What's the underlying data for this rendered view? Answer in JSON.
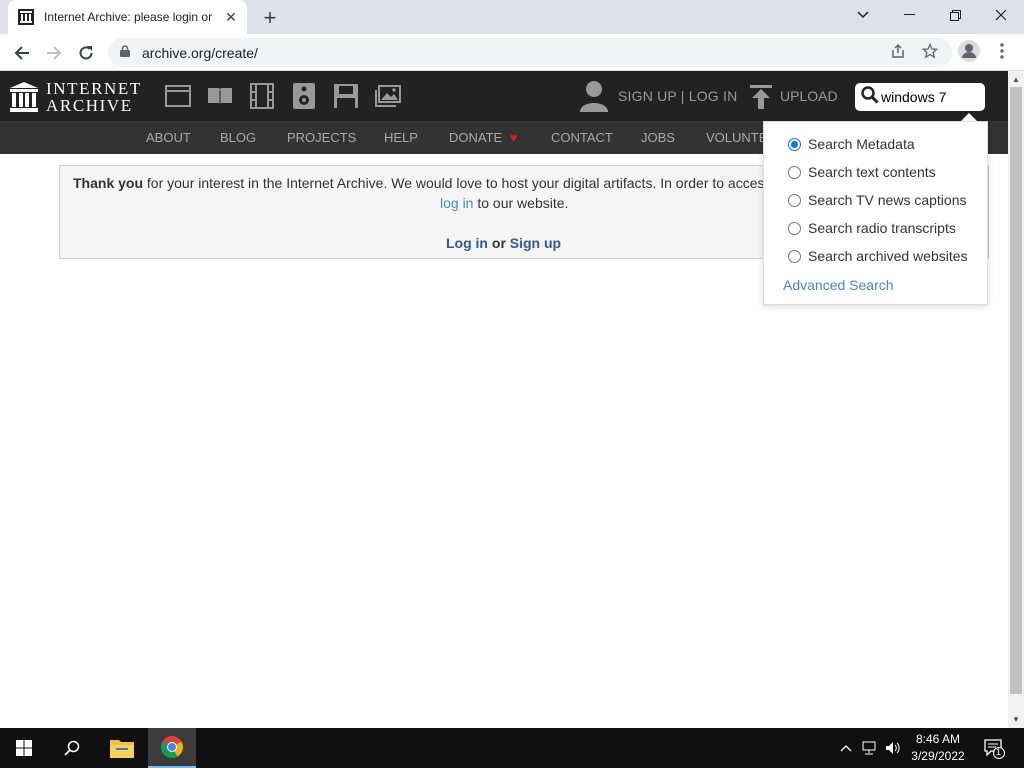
{
  "browser": {
    "tab_title": "Internet Archive: please login or s",
    "url": "archive.org/create/"
  },
  "ia": {
    "logo_line1": "INTERNET",
    "logo_line2": "ARCHIVE",
    "signup_login": "SIGN UP | LOG IN",
    "upload": "UPLOAD",
    "search_value": "windows 7",
    "media_icons": [
      "web-icon",
      "texts-icon",
      "video-icon",
      "audio-icon",
      "software-icon",
      "images-icon"
    ],
    "subnav": [
      "ABOUT",
      "BLOG",
      "PROJECTS",
      "HELP",
      "DONATE",
      "CONTACT",
      "JOBS",
      "VOLUNTE"
    ]
  },
  "notice": {
    "thank_you": "Thank you",
    "line1_rest": " for your interest in the Internet Archive. We would love to host your digital artifacts. In order to access",
    "log_in_link": "log in",
    "line2_rest": " to our website.",
    "login_label": "Log in",
    "or_label": " or ",
    "signup_label": "Sign up"
  },
  "search_dropdown": {
    "options": [
      {
        "label": "Search Metadata",
        "checked": true
      },
      {
        "label": "Search text contents",
        "checked": false
      },
      {
        "label": "Search TV news captions",
        "checked": false
      },
      {
        "label": "Search radio transcripts",
        "checked": false
      },
      {
        "label": "Search archived websites",
        "checked": false
      }
    ],
    "advanced": "Advanced Search"
  },
  "taskbar": {
    "time": "8:46 AM",
    "date": "3/29/2022",
    "notification_count": "1"
  },
  "colors": {
    "ia_top": "#222222",
    "ia_sub": "#333333",
    "link": "#428bca",
    "donate_heart": "#e21c1c"
  }
}
